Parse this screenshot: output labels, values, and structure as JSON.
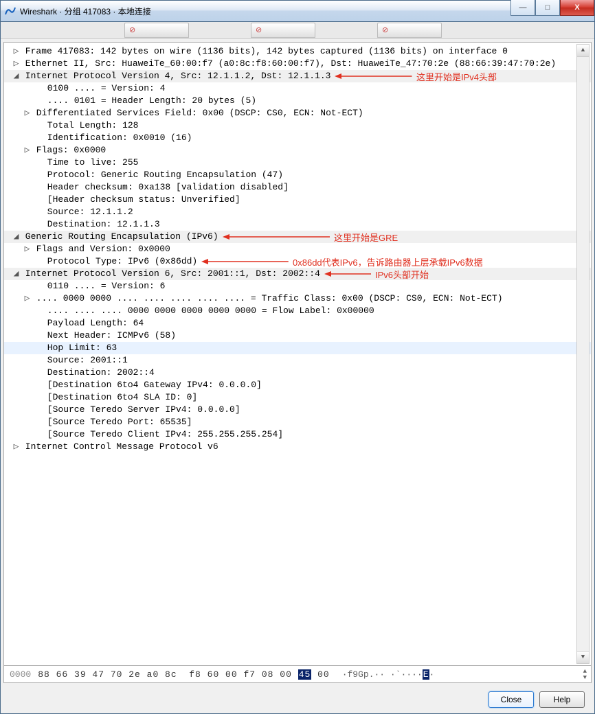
{
  "window": {
    "title": "Wireshark · 分组 417083 · 本地连接",
    "buttons": {
      "min": "—",
      "max": "□",
      "close": "X"
    }
  },
  "ghost_tabs": [
    "",
    "",
    ""
  ],
  "annotations": {
    "ipv4": "这里开始是IPv4头部",
    "gre": "这里开始是GRE",
    "greproto": "0x86dd代表IPv6，告诉路由器上层承载IPv6数据",
    "ipv6": "IPv6头部开始"
  },
  "tree": [
    {
      "ind": 0,
      "tw": "▷",
      "hd": false,
      "txt": "Frame 417083: 142 bytes on wire (1136 bits), 142 bytes captured (1136 bits) on interface 0"
    },
    {
      "ind": 0,
      "tw": "▷",
      "hd": false,
      "txt": "Ethernet II, Src: HuaweiTe_60:00:f7 (a0:8c:f8:60:00:f7), Dst: HuaweiTe_47:70:2e (88:66:39:47:70:2e)"
    },
    {
      "ind": 0,
      "tw": "◢",
      "hd": true,
      "txt": "Internet Protocol Version 4, Src: 12.1.1.2, Dst: 12.1.1.3",
      "anchor": "ipv4"
    },
    {
      "ind": 2,
      "tw": "",
      "hd": false,
      "txt": "0100 .... = Version: 4"
    },
    {
      "ind": 2,
      "tw": "",
      "hd": false,
      "txt": ".... 0101 = Header Length: 20 bytes (5)"
    },
    {
      "ind": 1,
      "tw": "▷",
      "hd": false,
      "txt": "Differentiated Services Field: 0x00 (DSCP: CS0, ECN: Not-ECT)"
    },
    {
      "ind": 2,
      "tw": "",
      "hd": false,
      "txt": "Total Length: 128"
    },
    {
      "ind": 2,
      "tw": "",
      "hd": false,
      "txt": "Identification: 0x0010 (16)"
    },
    {
      "ind": 1,
      "tw": "▷",
      "hd": false,
      "txt": "Flags: 0x0000"
    },
    {
      "ind": 2,
      "tw": "",
      "hd": false,
      "txt": "Time to live: 255"
    },
    {
      "ind": 2,
      "tw": "",
      "hd": false,
      "txt": "Protocol: Generic Routing Encapsulation (47)"
    },
    {
      "ind": 2,
      "tw": "",
      "hd": false,
      "txt": "Header checksum: 0xa138 [validation disabled]"
    },
    {
      "ind": 2,
      "tw": "",
      "hd": false,
      "txt": "[Header checksum status: Unverified]"
    },
    {
      "ind": 2,
      "tw": "",
      "hd": false,
      "txt": "Source: 12.1.1.2"
    },
    {
      "ind": 2,
      "tw": "",
      "hd": false,
      "txt": "Destination: 12.1.1.3"
    },
    {
      "ind": 0,
      "tw": "◢",
      "hd": true,
      "txt": "Generic Routing Encapsulation (IPv6)",
      "anchor": "gre"
    },
    {
      "ind": 1,
      "tw": "▷",
      "hd": false,
      "txt": "Flags and Version: 0x0000"
    },
    {
      "ind": 2,
      "tw": "",
      "hd": false,
      "txt": "Protocol Type: IPv6 (0x86dd)",
      "anchor": "greproto"
    },
    {
      "ind": 0,
      "tw": "◢",
      "hd": true,
      "txt": "Internet Protocol Version 6, Src: 2001::1, Dst: 2002::4",
      "anchor": "ipv6"
    },
    {
      "ind": 2,
      "tw": "",
      "hd": false,
      "txt": "0110 .... = Version: 6"
    },
    {
      "ind": 1,
      "tw": "▷",
      "hd": false,
      "txt": ".... 0000 0000 .... .... .... .... .... = Traffic Class: 0x00 (DSCP: CS0, ECN: Not-ECT)"
    },
    {
      "ind": 2,
      "tw": "",
      "hd": false,
      "txt": ".... .... .... 0000 0000 0000 0000 0000 = Flow Label: 0x00000"
    },
    {
      "ind": 2,
      "tw": "",
      "hd": false,
      "txt": "Payload Length: 64"
    },
    {
      "ind": 2,
      "tw": "",
      "hd": false,
      "txt": "Next Header: ICMPv6 (58)"
    },
    {
      "ind": 2,
      "tw": "",
      "hd": false,
      "hl": true,
      "txt": "Hop Limit: 63"
    },
    {
      "ind": 2,
      "tw": "",
      "hd": false,
      "txt": "Source: 2001::1"
    },
    {
      "ind": 2,
      "tw": "",
      "hd": false,
      "txt": "Destination: 2002::4"
    },
    {
      "ind": 2,
      "tw": "",
      "hd": false,
      "txt": "[Destination 6to4 Gateway IPv4: 0.0.0.0]"
    },
    {
      "ind": 2,
      "tw": "",
      "hd": false,
      "txt": "[Destination 6to4 SLA ID: 0]"
    },
    {
      "ind": 2,
      "tw": "",
      "hd": false,
      "txt": "[Source Teredo Server IPv4: 0.0.0.0]"
    },
    {
      "ind": 2,
      "tw": "",
      "hd": false,
      "txt": "[Source Teredo Port: 65535]"
    },
    {
      "ind": 2,
      "tw": "",
      "hd": false,
      "txt": "[Source Teredo Client IPv4: 255.255.255.254]"
    },
    {
      "ind": 0,
      "tw": "▷",
      "hd": false,
      "txt": "Internet Control Message Protocol v6"
    }
  ],
  "hex": {
    "offset": "0000",
    "bytes_pre": "88 66 39 47 70 2e a0 8c  f8 60 00 f7 08 00 ",
    "bytes_sel": "45",
    "bytes_post": " 00",
    "ascii_pre": "·f9Gp.·· ·`····",
    "ascii_sel": "E",
    "ascii_post": "·"
  },
  "footer": {
    "close": "Close",
    "help": "Help"
  }
}
